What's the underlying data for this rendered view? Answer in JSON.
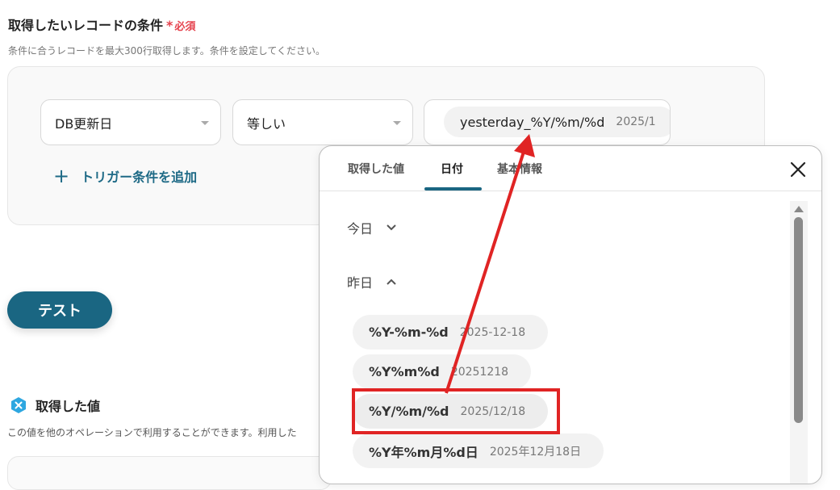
{
  "conditions": {
    "title": "取得したいレコードの条件",
    "required_star": "*",
    "required_label": "必須",
    "description": "条件に合うレコードを最大300行取得します。条件を設定してください。",
    "field_select": "DB更新日",
    "operator_select": "等しい",
    "value_chip": {
      "key": "yesterday_%Y/%m/%d",
      "value": "2025/1"
    },
    "add_condition": {
      "plus": "+",
      "label": "トリガー条件を追加"
    }
  },
  "test_button": "テスト",
  "retrieved": {
    "title": "取得した値",
    "description": "この値を他のオペレーションで利用することができます。利用した"
  },
  "popover": {
    "tabs": [
      {
        "label": "取得した値",
        "active": false
      },
      {
        "label": "日付",
        "active": true
      },
      {
        "label": "基本情報",
        "active": false
      }
    ],
    "sections": [
      {
        "label": "今日",
        "expanded": false
      },
      {
        "label": "昨日",
        "expanded": true
      }
    ],
    "options": [
      {
        "key": "%Y-%m-%d",
        "value": "2025-12-18",
        "selected": false
      },
      {
        "key": "%Y%m%d",
        "value": "20251218",
        "selected": false
      },
      {
        "key": "%Y/%m/%d",
        "value": "2025/12/18",
        "selected": true
      },
      {
        "key": "%Y年%m月%d日",
        "value": "2025年12月18日",
        "selected": false
      }
    ]
  },
  "colors": {
    "accent": "#1a6682",
    "required": "#e5424d",
    "highlight": "#e02424"
  },
  "icons": {
    "close": "close-icon",
    "chevron_down": "chevron-down-icon",
    "chevron_up": "chevron-up-icon",
    "retrieved": "hexagon-x-icon"
  }
}
